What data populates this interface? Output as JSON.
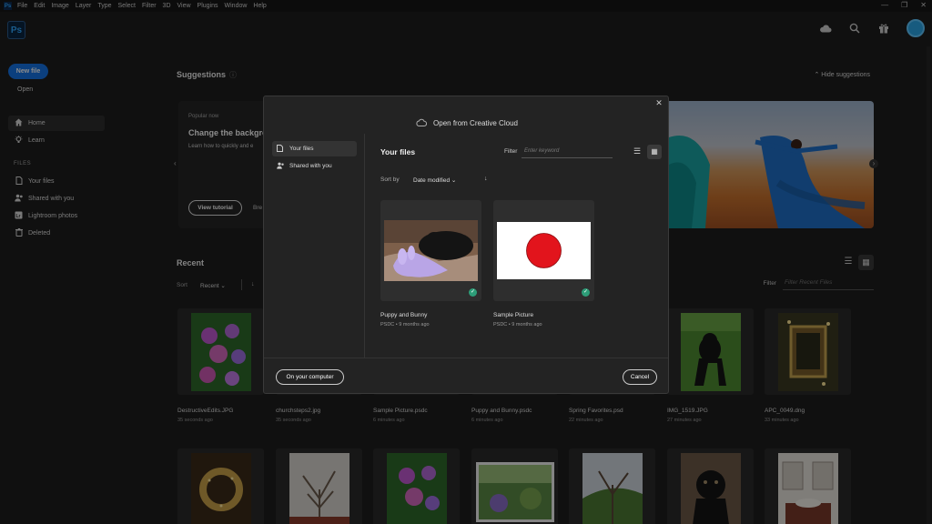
{
  "menubar": {
    "app_badge": "Ps",
    "items": [
      "File",
      "Edit",
      "Image",
      "Layer",
      "Type",
      "Select",
      "Filter",
      "3D",
      "View",
      "Plugins",
      "Window",
      "Help"
    ],
    "window_controls": [
      "—",
      "❐",
      "✕"
    ]
  },
  "topbar": {
    "logo": "Ps",
    "icons": [
      "cloud-icon",
      "search-icon",
      "gift-icon",
      "avatar"
    ]
  },
  "sidebar": {
    "new_file": "New file",
    "open": "Open",
    "home": "Home",
    "learn": "Learn",
    "files_header": "FILES",
    "your_files": "Your files",
    "shared_with_you": "Shared with you",
    "lightroom_photos": "Lightroom photos",
    "deleted": "Deleted"
  },
  "suggestions": {
    "title": "Suggestions",
    "hide": "Hide suggestions",
    "popular_now": "Popular now",
    "card_heading": "Change the backgro",
    "card_sub": "Learn how to quickly and e",
    "view_tutorial": "View tutorial",
    "second_button_partial": "Bre"
  },
  "recent": {
    "title": "Recent",
    "sort_label": "Sort",
    "sort_value": "Recent",
    "filter_label": "Filter",
    "filter_placeholder": "Filter Recent Files",
    "files": [
      {
        "name": "DestructiveEdits.JPG",
        "time": "35 seconds ago"
      },
      {
        "name": "churchsteps2.jpg",
        "time": "35 seconds ago"
      },
      {
        "name": "Sample Picture.psdc",
        "time": "6 minutes ago"
      },
      {
        "name": "Puppy and Bunny.psdc",
        "time": "6 minutes ago"
      },
      {
        "name": "Spring Favorites.psd",
        "time": "22 minutes ago"
      },
      {
        "name": "IMG_1519.JPG",
        "time": "27 minutes ago"
      },
      {
        "name": "APC_0049.dng",
        "time": "33 minutes ago"
      }
    ]
  },
  "modal": {
    "title": "Open from Creative Cloud",
    "nav_your_files": "Your files",
    "nav_shared": "Shared with you",
    "heading": "Your files",
    "filter_label": "Filter",
    "filter_placeholder": "Enter keyword",
    "sort_label": "Sort by",
    "sort_value": "Date modified",
    "files": [
      {
        "name": "Puppy and Bunny",
        "meta": "PSDC • 9 months ago"
      },
      {
        "name": "Sample Picture",
        "meta": "PSDC • 9 months ago"
      }
    ],
    "on_computer": "On your computer",
    "cancel": "Cancel"
  }
}
